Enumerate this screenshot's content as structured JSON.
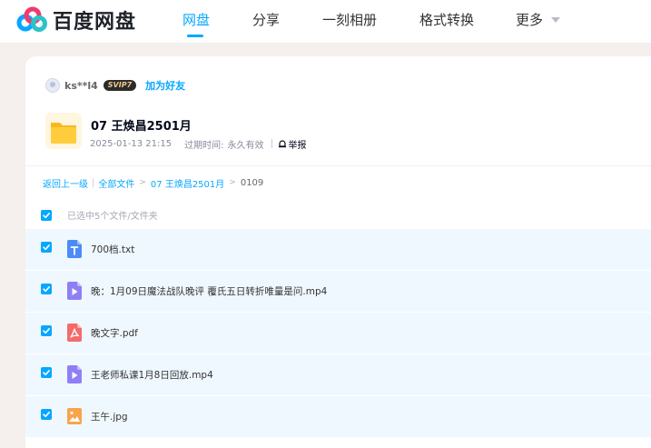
{
  "brand": {
    "name": "百度网盘",
    "colors": {
      "blue": "#06a7ff",
      "red": "#ef3b6c",
      "teal": "#2bc3c8"
    }
  },
  "nav": {
    "items": [
      {
        "label": "网盘",
        "active": true
      },
      {
        "label": "分享",
        "active": false
      },
      {
        "label": "一刻相册",
        "active": false
      },
      {
        "label": "格式转换",
        "active": false
      },
      {
        "label": "更多",
        "active": false
      }
    ],
    "more_icon": "chevron-down-icon"
  },
  "share": {
    "username": "ks**l4",
    "badge": "SVIP7",
    "add_friend": "加为好友",
    "folder_title": "07 王焕昌2501月",
    "created": "2025-01-13 21:15",
    "expiry_label": "过期时间:",
    "expiry_value": "永久有效",
    "report": "举报"
  },
  "breadcrumb": {
    "back": "返回上一级",
    "all_files": "全部文件",
    "parent": "07 王焕昌2501月",
    "current": "0109"
  },
  "selection": {
    "label": "已选中5个文件/文件夹",
    "all_checked": true
  },
  "files": [
    {
      "name": "700档.txt",
      "type": "txt",
      "icon": "text-file-icon",
      "checked": true
    },
    {
      "name": "晚：1月09日魔法战队晚评 覆氏五日转折唯量是问.mp4",
      "type": "video",
      "icon": "video-file-icon",
      "checked": true
    },
    {
      "name": "晚文字.pdf",
      "type": "pdf",
      "icon": "pdf-file-icon",
      "checked": true
    },
    {
      "name": "王老师私课1月8日回放.mp4",
      "type": "video",
      "icon": "video-file-icon",
      "checked": true
    },
    {
      "name": "王午.jpg",
      "type": "image",
      "icon": "image-file-icon",
      "checked": true
    }
  ]
}
